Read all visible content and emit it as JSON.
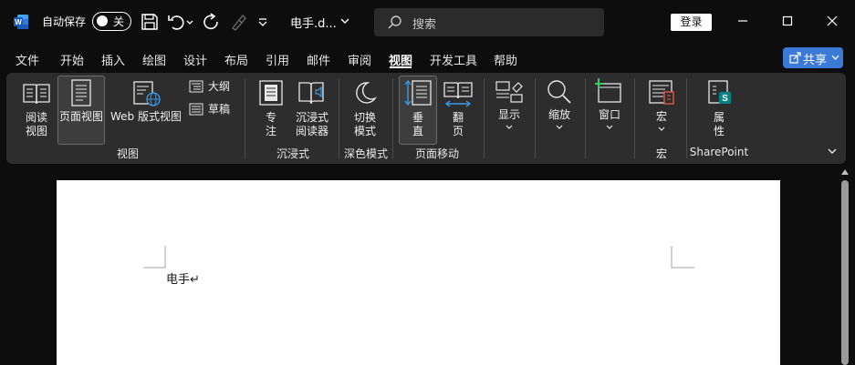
{
  "titlebar": {
    "app_icon": "word-logo-icon",
    "autosave_label": "自动保存",
    "autosave_toggle": "关",
    "doc_title": "电手.d...",
    "search_placeholder": "搜索",
    "login_label": "登录"
  },
  "tabs": [
    {
      "label": "文件"
    },
    {
      "label": "开始"
    },
    {
      "label": "插入"
    },
    {
      "label": "绘图"
    },
    {
      "label": "设计"
    },
    {
      "label": "布局"
    },
    {
      "label": "引用"
    },
    {
      "label": "邮件"
    },
    {
      "label": "审阅"
    },
    {
      "label": "视图",
      "active": true
    },
    {
      "label": "开发工具"
    },
    {
      "label": "帮助"
    }
  ],
  "share": {
    "label": "共享"
  },
  "ribbon": {
    "views": {
      "read_mode": "阅读\n视图",
      "print_layout": "页面视图",
      "web_layout": "Web 版式视图",
      "outline": "大纲",
      "draft": "草稿",
      "group": "视图"
    },
    "immersive": {
      "focus": "专\n注",
      "immersive_reader": "沉浸式\n阅读器",
      "group": "沉浸式"
    },
    "dark_mode": {
      "switch_modes": "切换\n模式",
      "group": "深色模式"
    },
    "page_movement": {
      "vertical": "垂\n直",
      "side_to_side": "翻\n页",
      "group": "页面移动"
    },
    "show": {
      "label": "显示"
    },
    "zoom": {
      "label": "缩放"
    },
    "window": {
      "label": "窗口"
    },
    "macros": {
      "label": "宏",
      "group": "宏"
    },
    "sharepoint": {
      "label": "属\n性",
      "group": "SharePoint"
    }
  },
  "document": {
    "text": "电手↵"
  },
  "colors": {
    "background": "#0d0d0d",
    "ribbon": "#2d2d2d",
    "share_button": "#3a7ad6",
    "page": "#ffffff",
    "accent_blue": "#3c9be8"
  }
}
